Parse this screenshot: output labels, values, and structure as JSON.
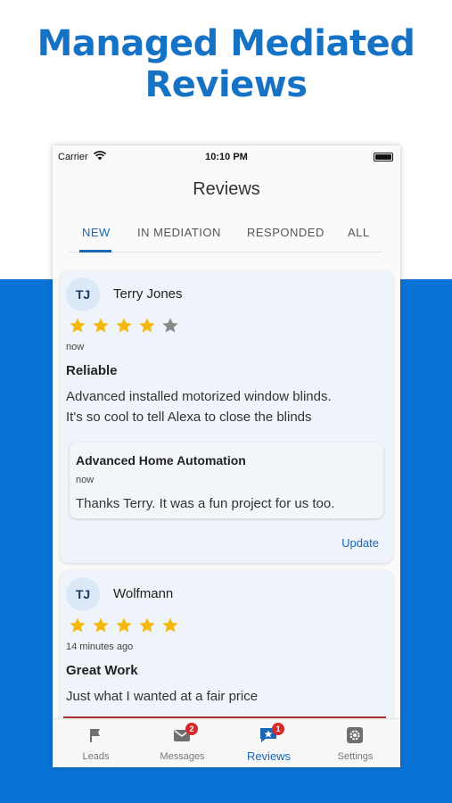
{
  "hero": {
    "line1": "Managed Mediated",
    "line2": "Reviews"
  },
  "status_bar": {
    "carrier": "Carrier",
    "time": "10:10 PM"
  },
  "app": {
    "title": "Reviews"
  },
  "tabs": [
    {
      "label": "NEW",
      "active": true
    },
    {
      "label": "IN MEDIATION",
      "active": false
    },
    {
      "label": "RESPONDED",
      "active": false
    },
    {
      "label": "ALL",
      "active": false
    }
  ],
  "reviews": [
    {
      "initials": "TJ",
      "name": "Terry Jones",
      "rating": 4,
      "max_rating": 5,
      "time": "now",
      "title": "Reliable",
      "body_line1": "Advanced installed motorized window blinds.",
      "body_line2": "It's so cool to tell Alexa to close the blinds",
      "reply": {
        "name": "Advanced Home Automation",
        "time": "now",
        "body": "Thanks Terry. It was a fun project for us too."
      },
      "action": "Update"
    },
    {
      "initials": "TJ",
      "name": "Wolfmann",
      "rating": 5,
      "max_rating": 5,
      "time": "14 minutes ago",
      "title": "Great Work",
      "body_line1": "Just what I wanted at a fair price"
    }
  ],
  "bottom_nav": [
    {
      "label": "Leads",
      "icon": "flag-icon",
      "active": false,
      "badge": ""
    },
    {
      "label": "Messages",
      "icon": "mail-icon",
      "active": false,
      "badge": "2"
    },
    {
      "label": "Reviews",
      "icon": "review-chat-icon",
      "active": true,
      "badge": "1"
    },
    {
      "label": "Settings",
      "icon": "gear-icon",
      "active": false,
      "badge": ""
    }
  ],
  "colors": {
    "brand_blue": "#0a74d6",
    "accent": "#1a67b5",
    "star_filled": "#f5b80f",
    "star_empty": "#8a8a8a",
    "badge_red": "#d62a2a"
  }
}
